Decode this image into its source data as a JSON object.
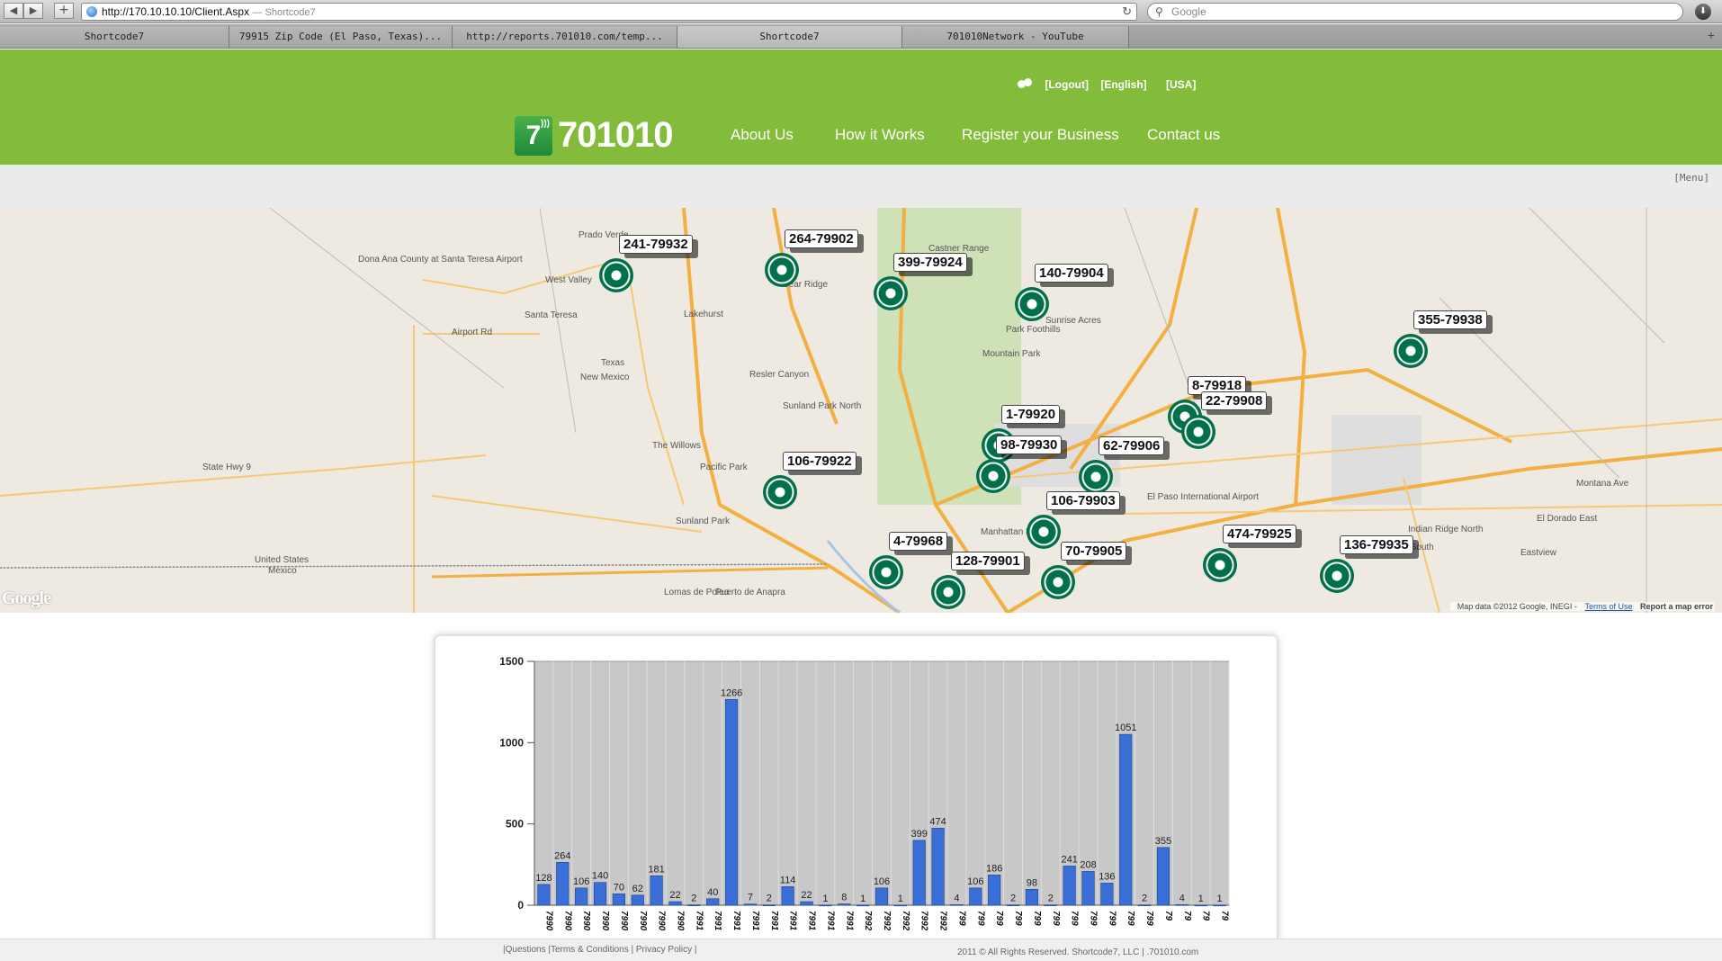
{
  "browser": {
    "url": "http://170.10.10.10/Client.Aspx",
    "page_title": "— Shortcode7",
    "search_placeholder": "Google",
    "tabs": [
      {
        "label": "Shortcode7",
        "active": false
      },
      {
        "label": "79915 Zip Code (El Paso, Texas)...",
        "active": false
      },
      {
        "label": "http://reports.701010.com/temp...",
        "active": false
      },
      {
        "label": "Shortcode7",
        "active": true
      },
      {
        "label": "701010Network - YouTube",
        "active": false
      }
    ]
  },
  "site": {
    "brand_color": "#82bc3a",
    "logo_text": "701010",
    "logo_mark": "7",
    "top_links": {
      "logout": "[Logout]",
      "english": "[English]",
      "usa": "[USA]"
    },
    "nav": [
      "About Us",
      "How it Works",
      "Register your Business",
      "Contact us"
    ],
    "menu_link": "[Menu]"
  },
  "map": {
    "google_logo": "Google",
    "attribution": "Map data ©2012 Google, INEGI -",
    "terms": "Terms of Use",
    "report": "Report a map error",
    "marker_color": "#00704a",
    "markers": [
      "241-79932",
      "264-79902",
      "399-79924",
      "140-79904",
      "355-79938",
      "8-79918",
      "22-79908",
      "1-79920",
      "98-79930",
      "62-79906",
      "106-79922",
      "106-79903",
      "474-79925",
      "136-79935",
      "4-79968",
      "128-79901",
      "70-79905"
    ],
    "labels": [
      "Dona Ana County at Santa Teresa Airport",
      "Prado Verde",
      "West Valley",
      "Santa Teresa",
      "Lakehurst",
      "Resler Canyon",
      "Sunland Park North",
      "The Willows",
      "Pacific Park",
      "Sunland Park",
      "Castner Range",
      "Mountain Park",
      "Sunrise Acres",
      "Park Foothills",
      "Manhattan Heights",
      "El Paso International Airport",
      "Eastview",
      "El Dorado East",
      "Indian Ridge North",
      "Pebble Hills South",
      "United States",
      "Mexico",
      "Lomas de Poleo",
      "Puerto de Anapra",
      "Bear Ridge",
      "State Hwy 9",
      "Montana Ave",
      "Airport Rd",
      "New Mexico",
      "Texas"
    ]
  },
  "footer": {
    "links": "|Questions |Terms & Conditions | Privacy Policy |",
    "copyright": "2011 © All Rights Reserved. Shortcode7, LLC | .701010.com"
  },
  "chart_data": {
    "type": "bar",
    "ylim": [
      0,
      1500
    ],
    "yticks": [
      0,
      500,
      1000,
      1500
    ],
    "bar_color": "#3a6fd8",
    "values": [
      128,
      264,
      106,
      140,
      70,
      62,
      181,
      22,
      2,
      40,
      1266,
      7,
      2,
      114,
      22,
      1,
      8,
      1,
      106,
      1,
      399,
      474,
      4,
      106,
      186,
      2,
      98,
      2,
      241,
      208,
      136,
      1051,
      2,
      355,
      4,
      1,
      1
    ],
    "categories": [
      "7990",
      "7990",
      "7990",
      "7990",
      "7990",
      "7990",
      "7990",
      "7990",
      "7991",
      "7991",
      "7991",
      "7991",
      "7991",
      "7991",
      "7991",
      "7991",
      "7991",
      "7992",
      "7992",
      "7992",
      "7992",
      "7992",
      "799",
      "799",
      "799",
      "799",
      "799",
      "799",
      "799",
      "799",
      "799",
      "799",
      "799",
      "79",
      "79",
      "79",
      "79"
    ]
  }
}
